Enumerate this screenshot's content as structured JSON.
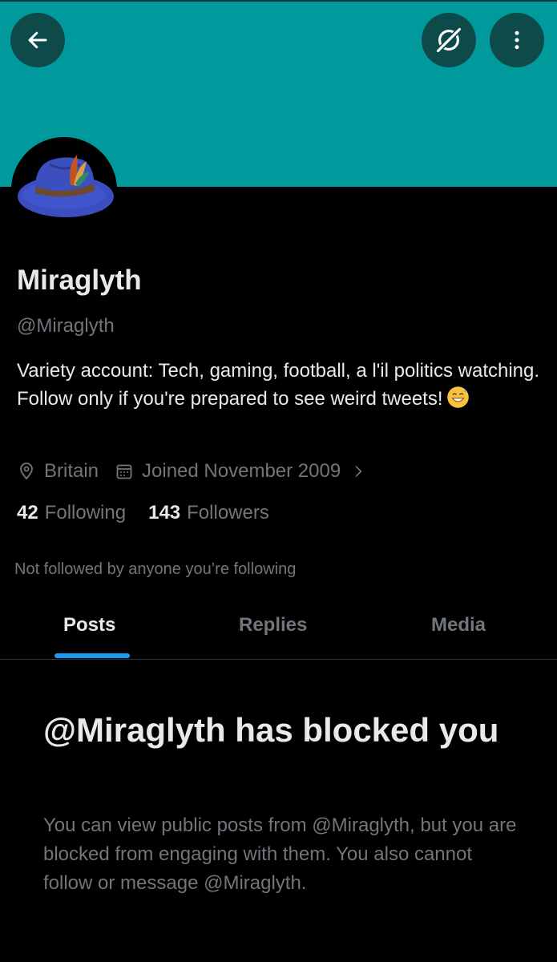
{
  "colors": {
    "banner": "#00999c",
    "button_bg": "#0f4a4a",
    "accent": "#1d9bf0",
    "text_primary": "#e7e9ea",
    "text_secondary": "#71767b",
    "background": "#000000"
  },
  "header": {
    "back_icon": "arrow-left-icon",
    "grok_icon": "grok-icon",
    "more_icon": "more-vertical-icon"
  },
  "profile": {
    "name": "Miraglyth",
    "handle": "@Miraglyth",
    "bio": "Variety account: Tech, gaming, football, a l'il politics watching. Follow only if you're prepared to see weird tweets!",
    "bio_emoji": "grinning-face-with-sweat-emoji",
    "location": "Britain",
    "joined": "Joined November 2009",
    "following_count": "42",
    "following_label": "Following",
    "followers_count": "143",
    "followers_label": "Followers",
    "not_followed_text": "Not followed by anyone you’re following"
  },
  "tabs": [
    {
      "label": "Posts",
      "active": true
    },
    {
      "label": "Replies",
      "active": false
    },
    {
      "label": "Media",
      "active": false
    }
  ],
  "blocked": {
    "title": "@Miraglyth has blocked you",
    "description": "You can view public posts from @Miraglyth, but you are blocked from engaging with them. You also cannot follow or message @Miraglyth."
  }
}
